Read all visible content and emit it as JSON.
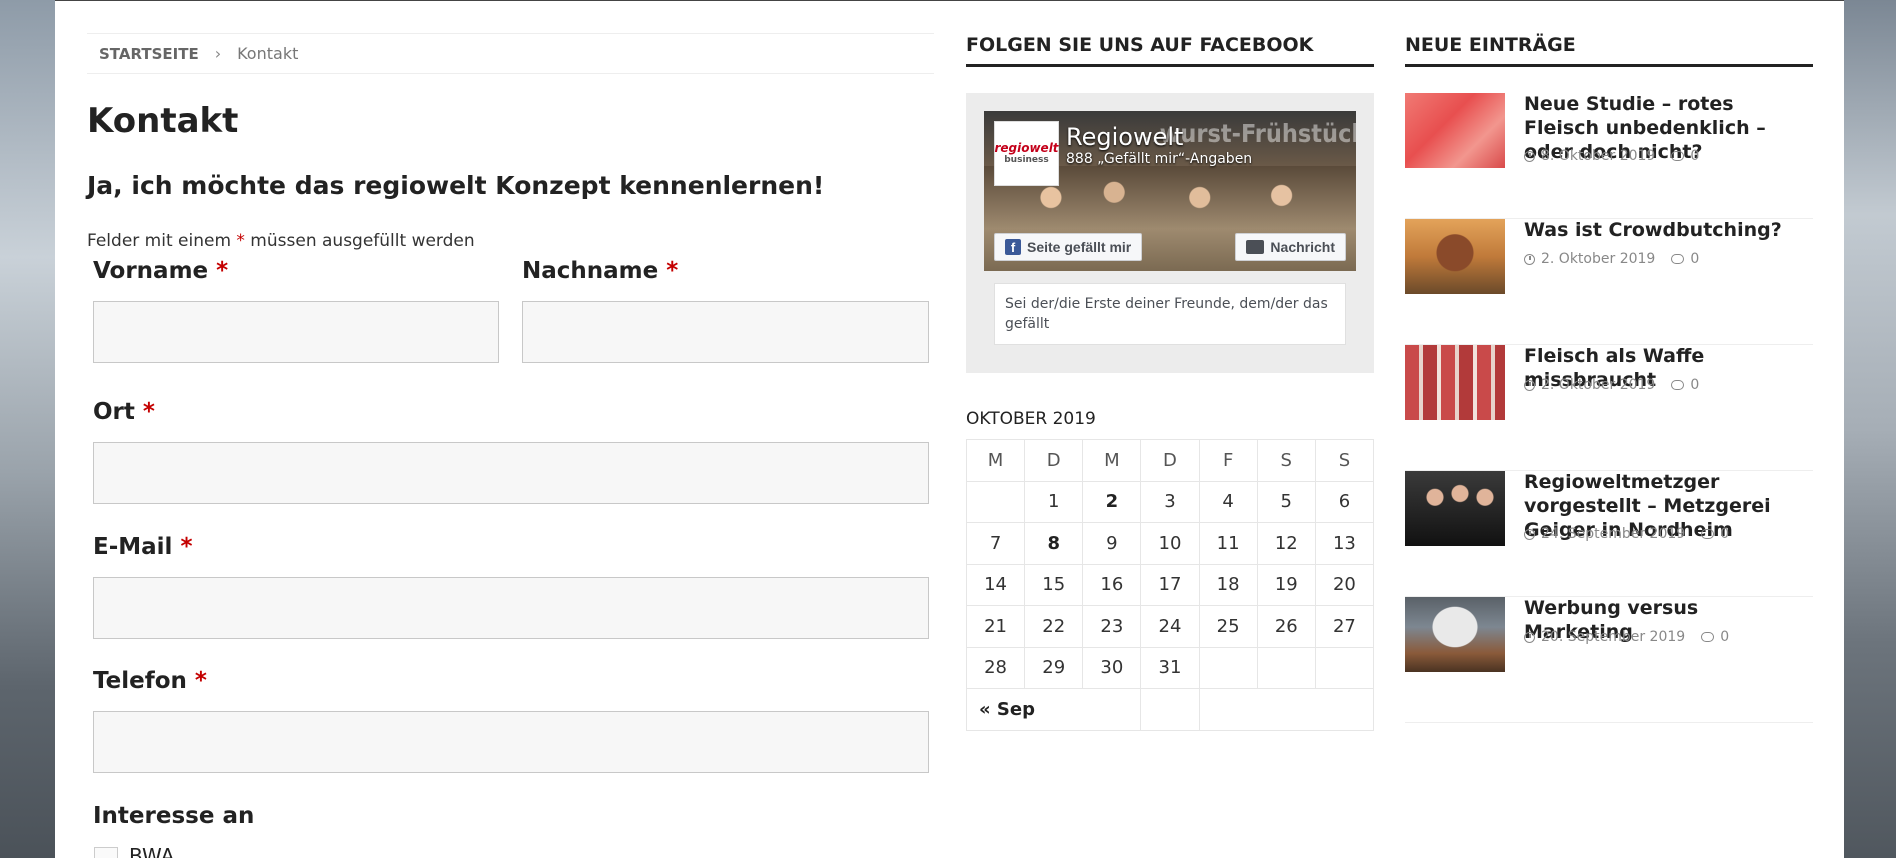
{
  "breadcrumb": {
    "home": "Startseite",
    "separator": "›",
    "current": "Kontakt"
  },
  "page": {
    "title": "Kontakt"
  },
  "form": {
    "title": "Ja, ich möchte das regiowelt Konzept kennenlernen!",
    "required_note_before": "Felder mit einem ",
    "required_star": "*",
    "required_note_after": " müssen ausgefüllt werden",
    "fields": {
      "vorname": {
        "label": "Vorname",
        "value": ""
      },
      "nachname": {
        "label": "Nachname",
        "value": ""
      },
      "ort": {
        "label": "Ort",
        "value": ""
      },
      "email": {
        "label": "E-Mail",
        "value": ""
      },
      "telefon": {
        "label": "Telefon",
        "value": ""
      }
    },
    "interest": {
      "label": "Interesse an",
      "options": [
        "BWA"
      ]
    }
  },
  "facebook": {
    "widget_title": "Folgen Sie uns auf Facebook",
    "page_name": "Regiowelt",
    "likes": "888 „Gefällt mir“-Angaben",
    "cover_text": "...wurst-Frühstück",
    "logo_text": "regiowelt",
    "logo_sub": "business",
    "like_button": "Seite gefällt mir",
    "message_button": "Nachricht",
    "friends_text": "Sei der/die Erste deiner Freunde, dem/der das gefällt"
  },
  "calendar": {
    "caption": "OKTOBER 2019",
    "weekdays": [
      "M",
      "D",
      "M",
      "D",
      "F",
      "S",
      "S"
    ],
    "weeks": [
      [
        "",
        "1",
        "2",
        "3",
        "4",
        "5",
        "6"
      ],
      [
        "7",
        "8",
        "9",
        "10",
        "11",
        "12",
        "13"
      ],
      [
        "14",
        "15",
        "16",
        "17",
        "18",
        "19",
        "20"
      ],
      [
        "21",
        "22",
        "23",
        "24",
        "25",
        "26",
        "27"
      ],
      [
        "28",
        "29",
        "30",
        "31",
        "",
        "",
        ""
      ]
    ],
    "bold_days": [
      "2",
      "8"
    ],
    "prev_link": "« Sep"
  },
  "recent": {
    "widget_title": "Neue Einträge",
    "posts": [
      {
        "title": "Neue Studie – rotes Fleisch unbedenklich – oder doch nicht?",
        "date": "8. Oktober 2019",
        "comments": "0"
      },
      {
        "title": "Was ist Crowdbutching?",
        "date": "2. Oktober 2019",
        "comments": "0"
      },
      {
        "title": "Fleisch als Waffe missbraucht",
        "date": "2. Oktober 2019",
        "comments": "0"
      },
      {
        "title": "Regioweltmetzger vorgestellt – Metzgerei Geiger in Nordheim",
        "date": "24. September 2019",
        "comments": "0"
      },
      {
        "title": "Werbung versus Marketing",
        "date": "20. September 2019",
        "comments": "0"
      }
    ]
  }
}
